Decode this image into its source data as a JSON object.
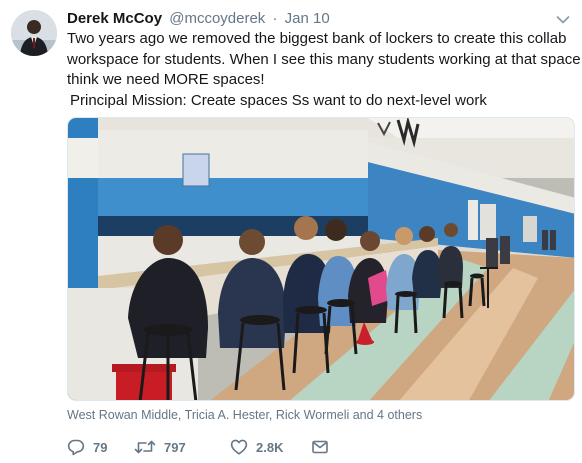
{
  "tweet": {
    "author_name": "Derek McCoy",
    "author_handle": "@mccoyderek",
    "separator": "·",
    "date": "Jan 10",
    "text_lines": [
      "Two years ago we removed the biggest bank of lockers to create this collab",
      "workspace for students. When I  see this many students working at that space, I",
      "think we need MORE spaces!",
      "Principal Mission: Create spaces Ss want to do next-level work"
    ],
    "tagged_people": "West Rowan Middle, Tricia A. Hester, Rick Wormeli and 4 others",
    "stats": {
      "replies": "79",
      "retweets": "797",
      "likes": "2.8K"
    }
  },
  "icons": {
    "menu": "chevron-down-icon",
    "reply": "reply-icon",
    "retweet": "retweet-icon",
    "like": "heart-icon",
    "message": "envelope-icon"
  },
  "colors": {
    "name": "#14171a",
    "secondary_text": "#657786",
    "wall_blue": "#3f8fcc",
    "hallway_floor": "#d8b48a"
  }
}
